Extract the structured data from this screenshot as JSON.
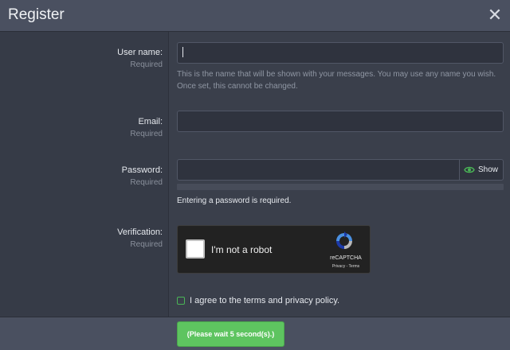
{
  "dialog": {
    "title": "Register",
    "close_symbol": "✕"
  },
  "fields": {
    "username": {
      "label": "User name:",
      "required": "Required",
      "value": "",
      "hint": "This is the name that will be shown with your messages. You may use any name you wish. Once set, this cannot be changed."
    },
    "email": {
      "label": "Email:",
      "required": "Required",
      "value": ""
    },
    "password": {
      "label": "Password:",
      "required": "Required",
      "value": "",
      "show_label": "Show",
      "message": "Entering a password is required."
    },
    "verification": {
      "label": "Verification:",
      "required": "Required",
      "captcha_text": "I'm not a robot",
      "captcha_brand": "reCAPTCHA",
      "captcha_links": "Privacy - Terms"
    }
  },
  "agree": {
    "label": "I agree to the terms and privacy policy.",
    "checked": false
  },
  "footer": {
    "submit_label": "(Please wait 5 second(s).)"
  },
  "colors": {
    "accent_green": "#5ec460",
    "header_bg": "#4a5060",
    "body_bg": "#363b47"
  },
  "icons": {
    "close": "close-icon",
    "eye": "eye-icon",
    "recaptcha": "recaptcha-logo-icon"
  }
}
